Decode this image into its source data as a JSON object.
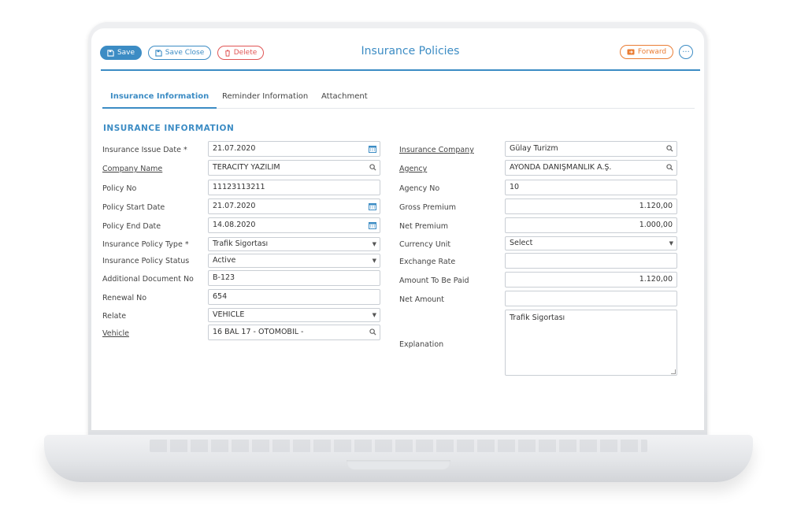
{
  "toolbar": {
    "save_label": "Save",
    "save_close_label": "Save Close",
    "delete_label": "Delete",
    "forward_label": "Forward",
    "more_label": "···"
  },
  "page": {
    "title": "Insurance Policies"
  },
  "tabs": [
    {
      "label": "Insurance Information",
      "active": true
    },
    {
      "label": "Reminder Information",
      "active": false
    },
    {
      "label": "Attachment",
      "active": false
    }
  ],
  "section_title": "INSURANCE INFORMATION",
  "left_fields": [
    {
      "label": "Insurance Issue Date *",
      "value": "21.07.2020",
      "icon": "calendar-icon"
    },
    {
      "label": "Company Name",
      "value": "TERACITY YAZILIM",
      "icon": "search-icon"
    },
    {
      "label": "Policy No",
      "value": "11123113211"
    },
    {
      "label": "Policy Start Date",
      "value": "21.07.2020",
      "icon": "calendar-icon"
    },
    {
      "label": "Policy End Date",
      "value": "14.08.2020",
      "icon": "calendar-icon"
    },
    {
      "label": "Insurance Policy Type *",
      "value": "Trafik Sigortası",
      "icon": "chevron-down-icon"
    },
    {
      "label": "Insurance Policy Status",
      "value": "Active",
      "icon": "chevron-down-icon"
    },
    {
      "label": "Additional Document No",
      "value": "B-123"
    },
    {
      "label": "Renewal No",
      "value": "654"
    },
    {
      "label": "Relate",
      "value": "VEHICLE",
      "icon": "chevron-down-icon"
    },
    {
      "label": "Vehicle",
      "value": "16 BAL 17 - OTOMOBIL -",
      "icon": "search-icon"
    }
  ],
  "right_fields": [
    {
      "label": "Insurance Company",
      "value": "Gülay Turizm",
      "icon": "search-icon"
    },
    {
      "label": "Agency",
      "value": "AYONDA DANIŞMANLIK A.Ş.",
      "icon": "search-icon"
    },
    {
      "label": "Agency No",
      "value": "10"
    },
    {
      "label": "Gross Premium",
      "value": "1.120,00"
    },
    {
      "label": "Net Premium",
      "value": "1.000,00"
    },
    {
      "label": "Currency Unit",
      "value": "Select",
      "icon": "chevron-down-icon"
    },
    {
      "label": "Exchange Rate",
      "value": ""
    },
    {
      "label": "Amount To Be Paid",
      "value": "1.120,00"
    },
    {
      "label": "Net Amount",
      "value": ""
    },
    {
      "label": "Explanation",
      "value": "Trafik Sigortası"
    }
  ],
  "colors": {
    "accent": "#3c8cc4",
    "danger": "#e05555",
    "forward": "#ea7d34"
  }
}
